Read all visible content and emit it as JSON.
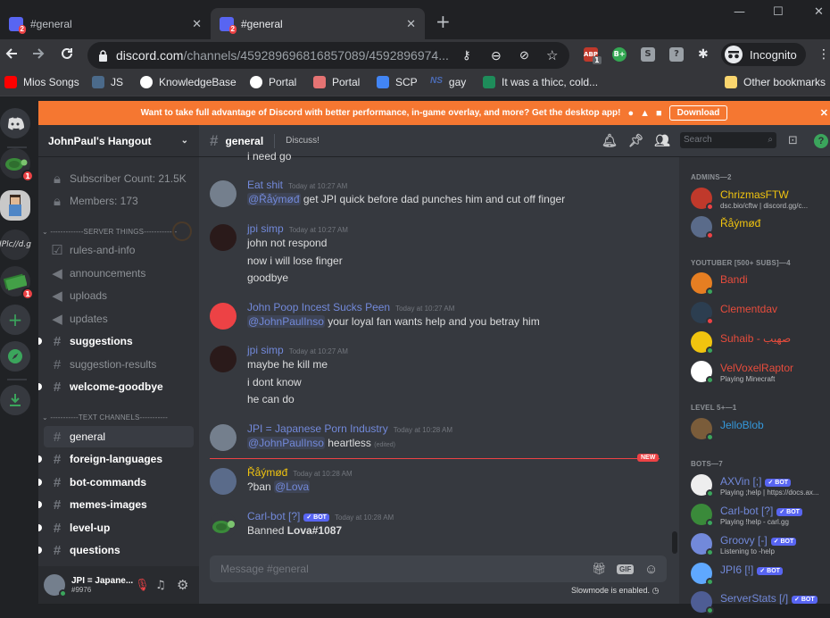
{
  "browser": {
    "tabs": [
      {
        "title": "#general",
        "badge": "2"
      },
      {
        "title": "#general",
        "badge": "2"
      }
    ],
    "url_host": "discord.com",
    "url_path": "/channels/459289696816857089/4592896974...",
    "profile": "Incognito",
    "ext_badge": "1",
    "bookmarks": [
      "Mios Songs",
      "JS",
      "KnowledgeBase",
      "Portal",
      "Portal",
      "SCP",
      "gay",
      "It was a thicc, cold...",
      "Other bookmarks"
    ]
  },
  "banner": {
    "text": "Want to take full advantage of Discord with better performance, in-game overlay, and more? Get the desktop app!",
    "download": "Download"
  },
  "guilds": {
    "server_badge": "1",
    "server3_label": "JPlc//d.g"
  },
  "server": {
    "name": "JohnPaul's Hangout",
    "top_channels": [
      "Subscriber Count: 21.5K",
      "Members: 173"
    ],
    "cat1": "-------------SERVER THINGS-------------",
    "cat1_channels": [
      "rules-and-info",
      "announcements",
      "uploads",
      "updates",
      "suggestions",
      "suggestion-results",
      "welcome-goodbye"
    ],
    "cat2": "-----------TEXT CHANNELS-----------",
    "cat2_channels": [
      "general",
      "foreign-languages",
      "bot-commands",
      "memes-images",
      "level-up",
      "questions"
    ]
  },
  "user": {
    "name": "JPI = Japane...",
    "tag": "#9976"
  },
  "channel": {
    "name": "general",
    "topic": "Discuss!",
    "search": "Search"
  },
  "messages": [
    {
      "partial": "i need go"
    },
    {
      "author": "Eat shit",
      "time": "Today at 10:27 AM",
      "mention": "@Řåýmøđ",
      "text": " get JPI quick before dad punches him and cut off finger"
    },
    {
      "author": "jpi simp",
      "time": "Today at 10:27 AM",
      "lines": [
        "john not respond",
        "now i will lose finger",
        "goodbye"
      ]
    },
    {
      "author": "John Poop Incest Sucks Peen",
      "time": "Today at 10:27 AM",
      "mention": "@JohnPaulInso",
      "text": " your loyal fan wants help and you betray him"
    },
    {
      "author": "jpi simp",
      "time": "Today at 10:27 AM",
      "lines": [
        "maybe he kill me",
        "i dont know",
        "he can do"
      ]
    },
    {
      "author": "JPI = Japanese Porn Industry",
      "time": "Today at 10:28 AM",
      "mention": "@JohnPaulInso",
      "text": " heartless",
      "edited": "(edited)"
    },
    {
      "author": "Řåýmøđ",
      "time": "Today at 10:28 AM",
      "text": "?ban ",
      "mention": "@Lova"
    },
    {
      "author": "Carl-bot [?]",
      "bot": "✓ BOT",
      "time": "Today at 10:28 AM",
      "text": "Banned ",
      "bold": "Lova#1087"
    }
  ],
  "new_label": "NEW",
  "composer": {
    "placeholder": "Message #general",
    "slowmode": "Slowmode is enabled."
  },
  "members": {
    "cats": [
      "ADMINS—2",
      "YOUTUBER [500+ SUBS]—4",
      "LEVEL 5+—1",
      "BOTS—7"
    ],
    "list": [
      {
        "name": "ChrizmasFTW",
        "sub": "dsc.bio/cftw | discord.gg/c...",
        "color": "#f1c40f"
      },
      {
        "name": "Řåýmøđ",
        "sub": "",
        "color": "#f1c40f"
      },
      {
        "name": "Bandi",
        "sub": "",
        "color": "#e74c3c"
      },
      {
        "name": "Clementdav",
        "sub": "",
        "color": "#e74c3c"
      },
      {
        "name": "Suhaib - صهيب",
        "sub": "",
        "color": "#e74c3c"
      },
      {
        "name": "VelVoxelRaptor",
        "sub": "Playing Minecraft",
        "color": "#e74c3c"
      },
      {
        "name": "JelloBlob",
        "sub": "",
        "color": "#3498db"
      },
      {
        "name": "AXVin [;]",
        "sub": "Playing ;help | https://docs.ax...",
        "color": "#7289da",
        "bot": "✓ BOT"
      },
      {
        "name": "Carl-bot [?]",
        "sub": "Playing !help - carl.gg",
        "color": "#7289da",
        "bot": "✓ BOT"
      },
      {
        "name": "Groovy [-]",
        "sub": "Listening to -help",
        "color": "#7289da",
        "bot": "✓ BOT"
      },
      {
        "name": "JPI6 [!]",
        "sub": "",
        "color": "#7289da",
        "bot": "✓ BOT"
      },
      {
        "name": "ServerStats [/]",
        "sub": "",
        "color": "#7289da",
        "bot": "✓ BOT"
      }
    ]
  },
  "colors": {
    "blurple": "#5865f2",
    "orange": "#f57731",
    "red": "#ed4245",
    "green": "#3ba55c"
  }
}
